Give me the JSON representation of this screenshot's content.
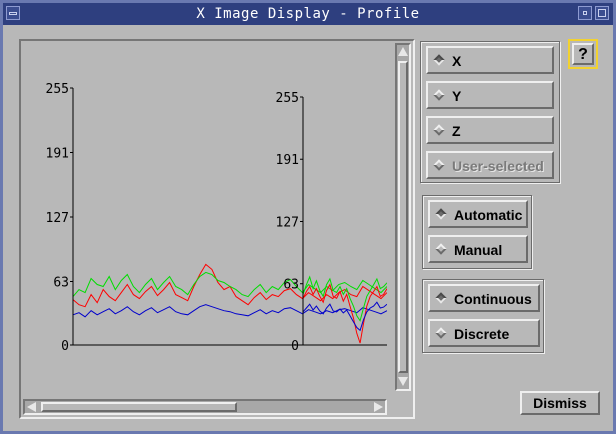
{
  "window": {
    "title": "X Image Display - Profile"
  },
  "help_button": {
    "label": "?"
  },
  "axis_group": {
    "options": [
      {
        "label": "X",
        "selected": true,
        "enabled": true
      },
      {
        "label": "Y",
        "selected": false,
        "enabled": true
      },
      {
        "label": "Z",
        "selected": false,
        "enabled": true
      },
      {
        "label": "User-selected",
        "selected": false,
        "enabled": false
      }
    ]
  },
  "scale_group": {
    "options": [
      {
        "label": "Automatic",
        "selected": true
      },
      {
        "label": "Manual",
        "selected": false
      }
    ]
  },
  "mode_group": {
    "options": [
      {
        "label": "Continuous",
        "selected": true
      },
      {
        "label": "Discrete",
        "selected": false
      }
    ]
  },
  "dismiss_button": {
    "label": "Dismiss"
  },
  "chart_data": [
    {
      "type": "line",
      "yticks": [
        "255",
        "191",
        "127",
        "63",
        "0"
      ],
      "ylim": [
        0,
        255
      ],
      "series": [
        {
          "color": "#ff0000",
          "values": [
            45,
            40,
            38,
            50,
            42,
            55,
            48,
            44,
            52,
            60,
            50,
            46,
            53,
            58,
            49,
            55,
            62,
            50,
            47,
            44,
            58,
            70,
            80,
            75,
            62,
            55,
            58,
            48,
            44,
            40,
            47,
            52,
            45,
            50,
            48,
            54,
            56,
            50,
            46,
            52,
            48,
            44,
            50,
            46,
            52,
            55,
            50,
            48,
            58,
            54,
            50,
            46,
            52
          ]
        },
        {
          "color": "#00dd00",
          "values": [
            48,
            55,
            52,
            66,
            60,
            58,
            68,
            55,
            64,
            70,
            58,
            52,
            60,
            66,
            55,
            62,
            68,
            58,
            55,
            50,
            60,
            68,
            72,
            70,
            64,
            62,
            58,
            55,
            50,
            48,
            55,
            60,
            52,
            58,
            55,
            62,
            65,
            58,
            52,
            60,
            56,
            52,
            58,
            54,
            60,
            62,
            58,
            55,
            64,
            60,
            56,
            52,
            58
          ]
        },
        {
          "color": "#0000cc",
          "values": [
            30,
            32,
            28,
            34,
            30,
            33,
            36,
            31,
            34,
            38,
            33,
            30,
            34,
            37,
            32,
            35,
            38,
            33,
            31,
            30,
            34,
            38,
            40,
            38,
            36,
            34,
            33,
            31,
            30,
            29,
            32,
            35,
            31,
            34,
            32,
            36,
            37,
            34,
            31,
            35,
            33,
            31,
            34,
            32,
            35,
            36,
            34,
            32,
            37,
            35,
            33,
            31,
            34
          ]
        }
      ]
    },
    {
      "type": "line",
      "yticks": [
        "255",
        "191",
        "127",
        "63",
        "0"
      ],
      "ylim": [
        0,
        255
      ],
      "series": [
        {
          "color": "#ff0000",
          "values": [
            48,
            55,
            60,
            52,
            58,
            50,
            44,
            56,
            62,
            50,
            48,
            55,
            45,
            52,
            40,
            28,
            12,
            2,
            22,
            40,
            50,
            55,
            60,
            50,
            52,
            58
          ]
        },
        {
          "color": "#00dd00",
          "values": [
            52,
            62,
            70,
            58,
            66,
            56,
            50,
            62,
            68,
            56,
            54,
            60,
            52,
            58,
            48,
            40,
            30,
            25,
            38,
            50,
            56,
            62,
            68,
            58,
            60,
            64
          ]
        },
        {
          "color": "#0000cc",
          "values": [
            34,
            38,
            42,
            36,
            40,
            35,
            32,
            38,
            42,
            35,
            34,
            37,
            33,
            36,
            30,
            24,
            18,
            15,
            26,
            34,
            38,
            40,
            44,
            38,
            39,
            42
          ]
        }
      ]
    }
  ]
}
